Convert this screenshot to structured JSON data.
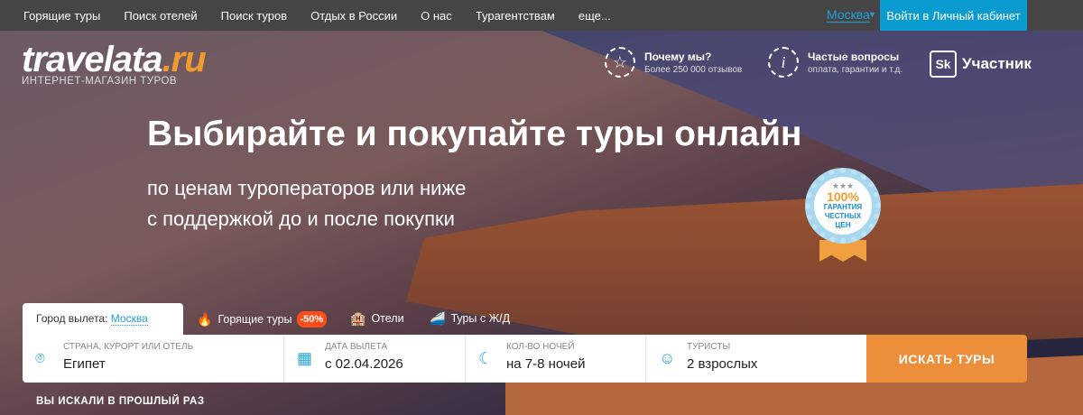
{
  "topnav": {
    "items": [
      "Горящие туры",
      "Поиск отелей",
      "Поиск туров",
      "Отдых в России",
      "О нас",
      "Турагентствам",
      "еще..."
    ],
    "city": "Москва",
    "login": "Войти в Личный кабинет"
  },
  "logo": {
    "main": "travelata",
    "ru": ".ru",
    "sub": "ИНТЕРНЕТ-МАГАЗИН ТУРОВ"
  },
  "features": [
    {
      "title": "Почему мы?",
      "sub": "Более 250 000 отзывов"
    },
    {
      "title": "Частые вопросы",
      "sub": "оплата, гарантии и т.д."
    }
  ],
  "skolkovo": {
    "mark": "Sk",
    "label": "Участник"
  },
  "hero": {
    "title": "Выбирайте и покупайте туры онлайн",
    "line1": "по ценам туроператоров или ниже",
    "line2": "с поддержкой до и после покупки"
  },
  "badge": {
    "pct": "100%",
    "l1": "ГАРАНТИЯ",
    "l2": "ЧЕСТНЫХ",
    "l3": "ЦЕН"
  },
  "tabs": {
    "departure_label": "Город вылета:",
    "departure_city": "Москва",
    "hot": "Горящие туры",
    "hot_badge": "-50%",
    "hotels": "Отели",
    "rail": "Туры с Ж/Д"
  },
  "form": {
    "destination": {
      "label": "СТРАНА, КУРОРТ ИЛИ ОТЕЛЬ",
      "value": "Египет"
    },
    "date": {
      "label": "ДАТА ВЫЛЕТА",
      "value": "с 02.04.2026"
    },
    "nights": {
      "label": "КОЛ-ВО НОЧЕЙ",
      "value": "на 7-8 ночей"
    },
    "tourists": {
      "label": "ТУРИСТЫ",
      "value": "2 взрослых"
    },
    "search": "ИСКАТЬ ТУРЫ"
  },
  "previous": "ВЫ ИСКАЛИ В ПРОШЛЫЙ РАЗ",
  "colors": {
    "accent": "#0a9bd0",
    "orange": "#ec8e3a",
    "hot": "#ff4d1a"
  }
}
